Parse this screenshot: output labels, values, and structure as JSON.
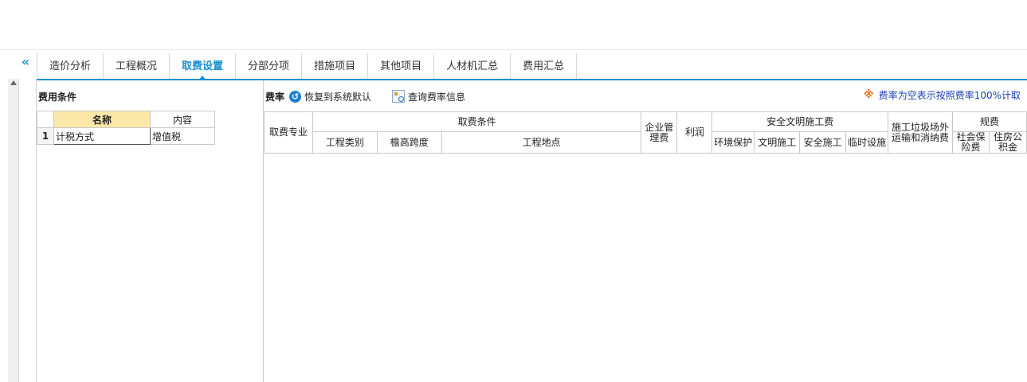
{
  "tabs": [
    {
      "label": "造价分析",
      "active": false
    },
    {
      "label": "工程概况",
      "active": false
    },
    {
      "label": "取费设置",
      "active": true
    },
    {
      "label": "分部分项",
      "active": false
    },
    {
      "label": "措施项目",
      "active": false
    },
    {
      "label": "其他项目",
      "active": false
    },
    {
      "label": "人材机汇总",
      "active": false
    },
    {
      "label": "费用汇总",
      "active": false
    }
  ],
  "collapse_glyph": "«",
  "left": {
    "title": "费用条件",
    "headers": {
      "name": "名称",
      "content": "内容"
    },
    "rows": [
      {
        "num": "1",
        "name": "计税方式",
        "content": "增值税"
      }
    ]
  },
  "right": {
    "toolbar_label": "费率",
    "restore_label": "恢复到系统默认",
    "query_label": "查询费率信息",
    "notice_icon": "※",
    "notice": "费率为空表示按照费率100%计取",
    "headers": {
      "specialty": "取费专业",
      "conditions": "取费条件",
      "project_type": "工程类别",
      "eave_span": "檐高跨度",
      "location": "工程地点",
      "mgmt_fee": "企业管理费",
      "profit": "利润",
      "safety": "安全文明施工费",
      "env": "环境保护",
      "civil": "文明施工",
      "safe": "安全施工",
      "temp": "临时设施",
      "garbage": "施工垃圾场外运输和消纳费",
      "regulation": "规费",
      "social": "社会保险费",
      "housing": "住房公积金"
    }
  },
  "colors": {
    "accent": "#1a8fd0",
    "selected_header": "#fbe7a8",
    "notice": "#1a3fb0"
  }
}
